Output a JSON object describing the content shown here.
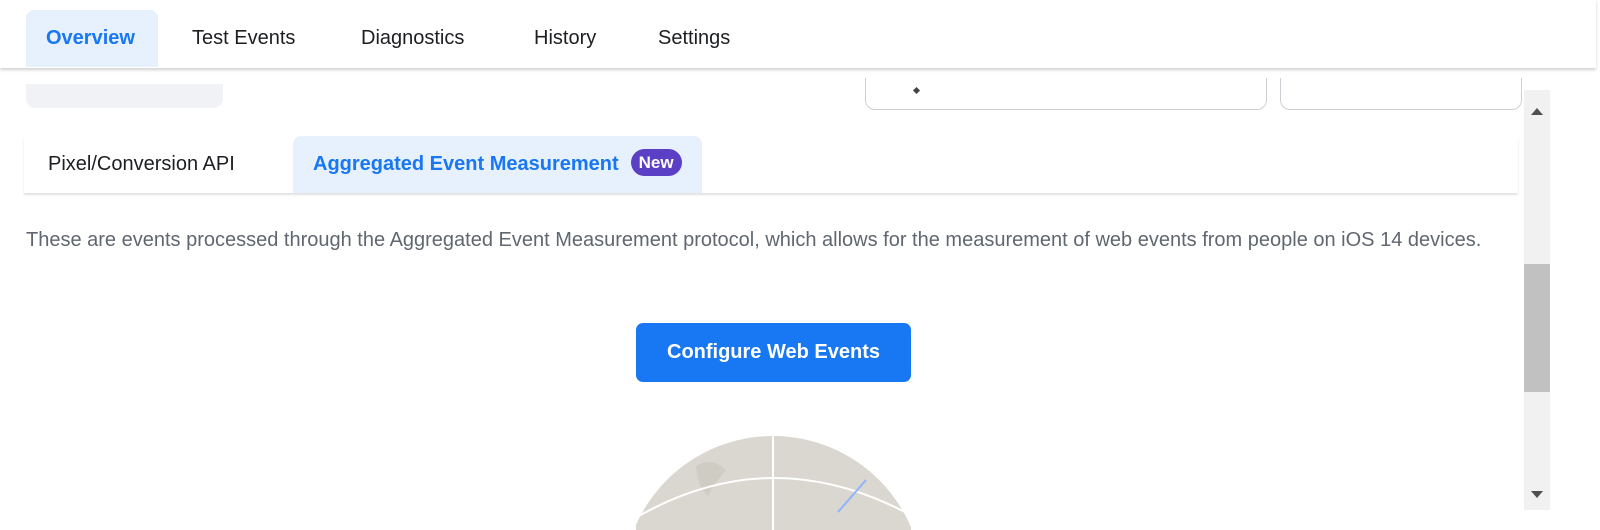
{
  "top_tabs": [
    {
      "label": "Overview",
      "active": true
    },
    {
      "label": "Test Events",
      "active": false
    },
    {
      "label": "Diagnostics",
      "active": false
    },
    {
      "label": "History",
      "active": false
    },
    {
      "label": "Settings",
      "active": false
    }
  ],
  "sub_tabs": [
    {
      "label": "Pixel/Conversion API",
      "active": false
    },
    {
      "label": "Aggregated Event Measurement",
      "active": true,
      "badge": "New"
    }
  ],
  "description": "These are events processed through the Aggregated Event Measurement protocol, which allows for the measurement of web events from people on iOS 14 devices.",
  "cta": {
    "label": "Configure Web Events"
  },
  "colors": {
    "accent": "#1877f2",
    "active_tab_bg": "#e7f0fd",
    "badge": "#5b3fc4",
    "text": "#1c1e21",
    "muted_text": "#606770",
    "illustration_fill": "#d9d7d0",
    "illustration_line": "#ffffff"
  },
  "icons": {
    "scroll_up": "triangle-up-icon",
    "scroll_down": "triangle-down-icon",
    "search": "search-icon"
  }
}
